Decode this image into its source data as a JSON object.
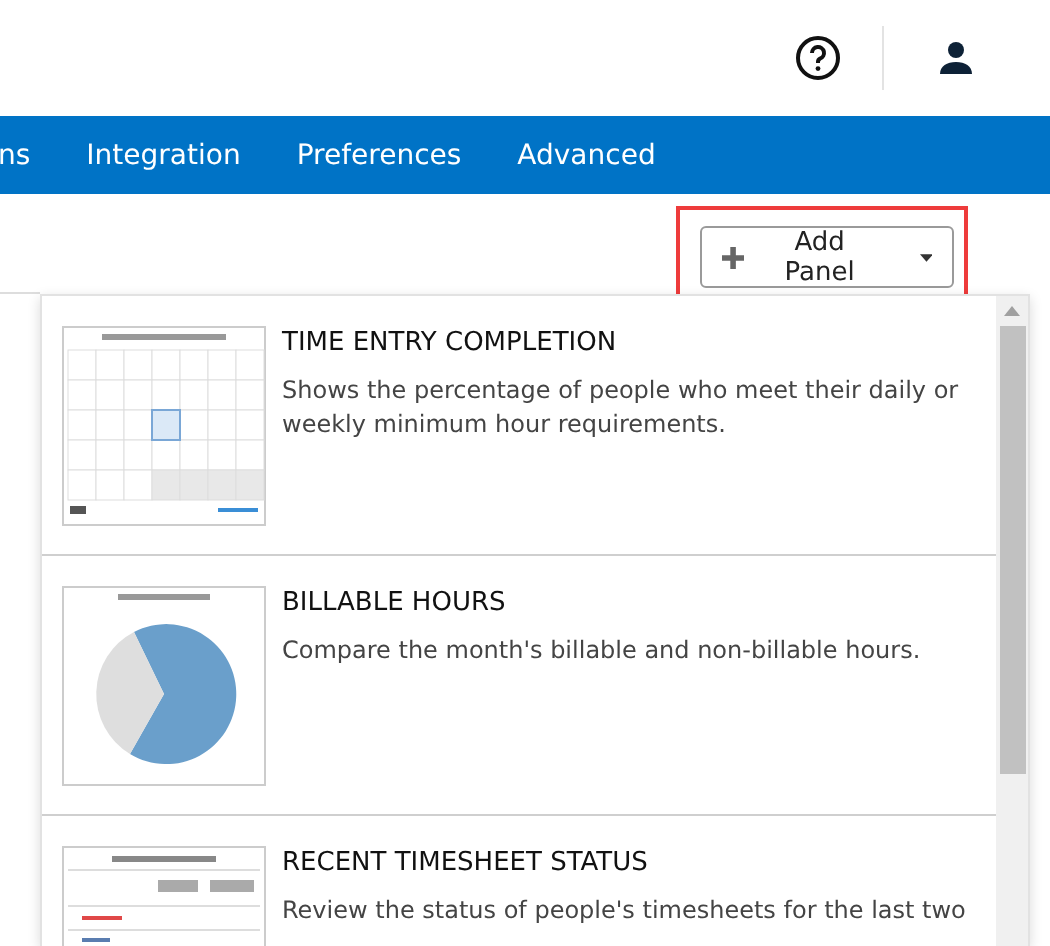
{
  "nav": {
    "items": [
      {
        "label": "ns"
      },
      {
        "label": "Integration"
      },
      {
        "label": "Preferences"
      },
      {
        "label": "Advanced"
      }
    ]
  },
  "add_button": {
    "label": "Add Panel"
  },
  "panels": [
    {
      "kind": "calendar",
      "title": "TIME ENTRY COMPLETION",
      "description": "Shows the percentage of people who meet their daily or weekly minimum hour requirements."
    },
    {
      "kind": "pie",
      "title": "BILLABLE HOURS",
      "description": "Compare the month's billable and non-billable hours."
    },
    {
      "kind": "table",
      "title": "RECENT TIMESHEET STATUS",
      "description": "Review the status of people's timesheets for the last two"
    }
  ]
}
